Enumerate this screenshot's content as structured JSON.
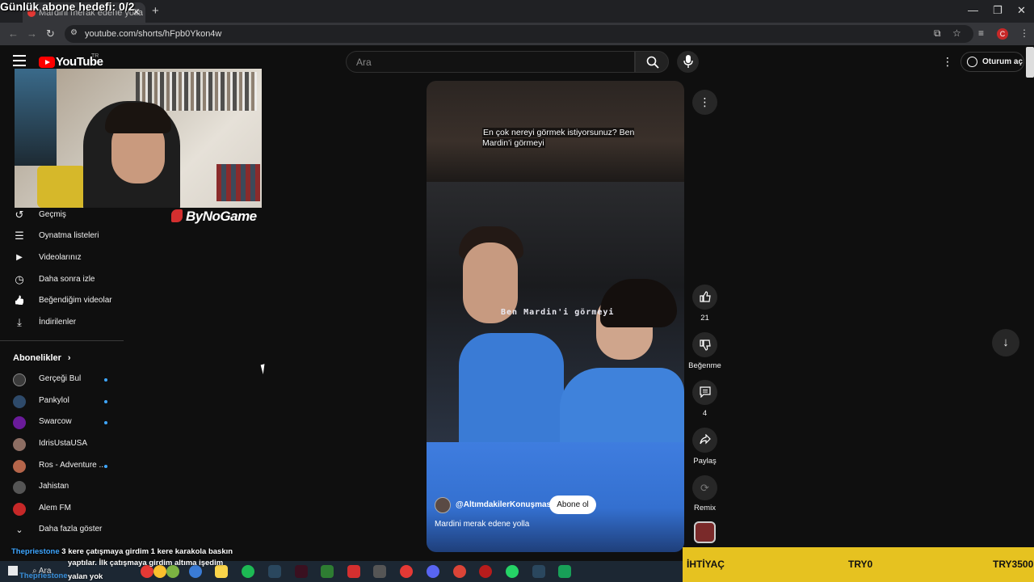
{
  "overlay": {
    "goal_text": "Günlük abone hedefi: 0/2"
  },
  "browser": {
    "tab_title": "Mardini merak edene yolla",
    "new_tab": "+",
    "url": "youtube.com/shorts/hFpb0Ykon4w",
    "profile_initial": "C",
    "window_controls": [
      "—",
      "❐",
      "✕"
    ]
  },
  "header": {
    "logo_text": "YouTube",
    "region": "TR",
    "search_placeholder": "Ara",
    "signin_label": "Oturum aç"
  },
  "webcam": {
    "brand": "ByNoGame"
  },
  "sidebar": {
    "items": [
      {
        "label": "Geçmiş",
        "icon": "history-icon",
        "glyph": "↺"
      },
      {
        "label": "Oynatma listeleri",
        "icon": "playlist-icon",
        "glyph": "☰"
      },
      {
        "label": "Videolarınız",
        "icon": "video-icon",
        "glyph": "▶"
      },
      {
        "label": "Daha sonra izle",
        "icon": "clock-icon",
        "glyph": "◷"
      },
      {
        "label": "Beğendiğim videolar",
        "icon": "thumbs-up-icon",
        "glyph": "👍"
      },
      {
        "label": "İndirilenler",
        "icon": "download-icon",
        "glyph": "⤓"
      }
    ],
    "subscriptions_heading": "Abonelikler",
    "subscriptions": [
      {
        "name": "Gerçeği Bul",
        "color": "#3b3b3b",
        "new": true
      },
      {
        "name": "Pankylol",
        "color": "#2e4a6a",
        "new": true
      },
      {
        "name": "Swarcow",
        "color": "#6a1b9a",
        "new": true
      },
      {
        "name": "IdrisUstaUSA",
        "color": "#8d6e63",
        "new": false
      },
      {
        "name": "Ros - Adventure ...",
        "color": "#b5654a",
        "new": true
      },
      {
        "name": "Jahistan",
        "color": "#555555",
        "new": false
      },
      {
        "name": "Alem FM",
        "color": "#c62828",
        "new": false
      }
    ],
    "show_more": "Daha fazla göster"
  },
  "short": {
    "caption_top": "En çok nereyi görmek istiyorsunuz? Ben Mardin'i görmeyi",
    "burned_subtitle": "Ben Mardin'i görmeyi",
    "channel": "@AltımdakilerKonuşmasın",
    "subscribe_label": "Abone ol",
    "title": "Mardini merak edene yolla"
  },
  "actions": {
    "like_count": "21",
    "dislike_label": "Beğenme",
    "comment_count": "4",
    "share_label": "Paylaş",
    "remix_label": "Remix"
  },
  "chat": {
    "user": "Thepriestone",
    "line1": "3 kere çatışmaya girdim 1 kere karakola baskın",
    "line2": "yaptılar. İlk çatışmaya girdim altıma işedim",
    "line3": "yalan yok"
  },
  "taskbar": {
    "search_label": "Ara"
  },
  "ticker": {
    "items": [
      "İHTİYAÇ",
      "TRY0",
      "TRY3500"
    ]
  },
  "colors": {
    "accent": "#ff0000",
    "ticker_bg": "#e6c220",
    "link": "#3ea6ff"
  }
}
